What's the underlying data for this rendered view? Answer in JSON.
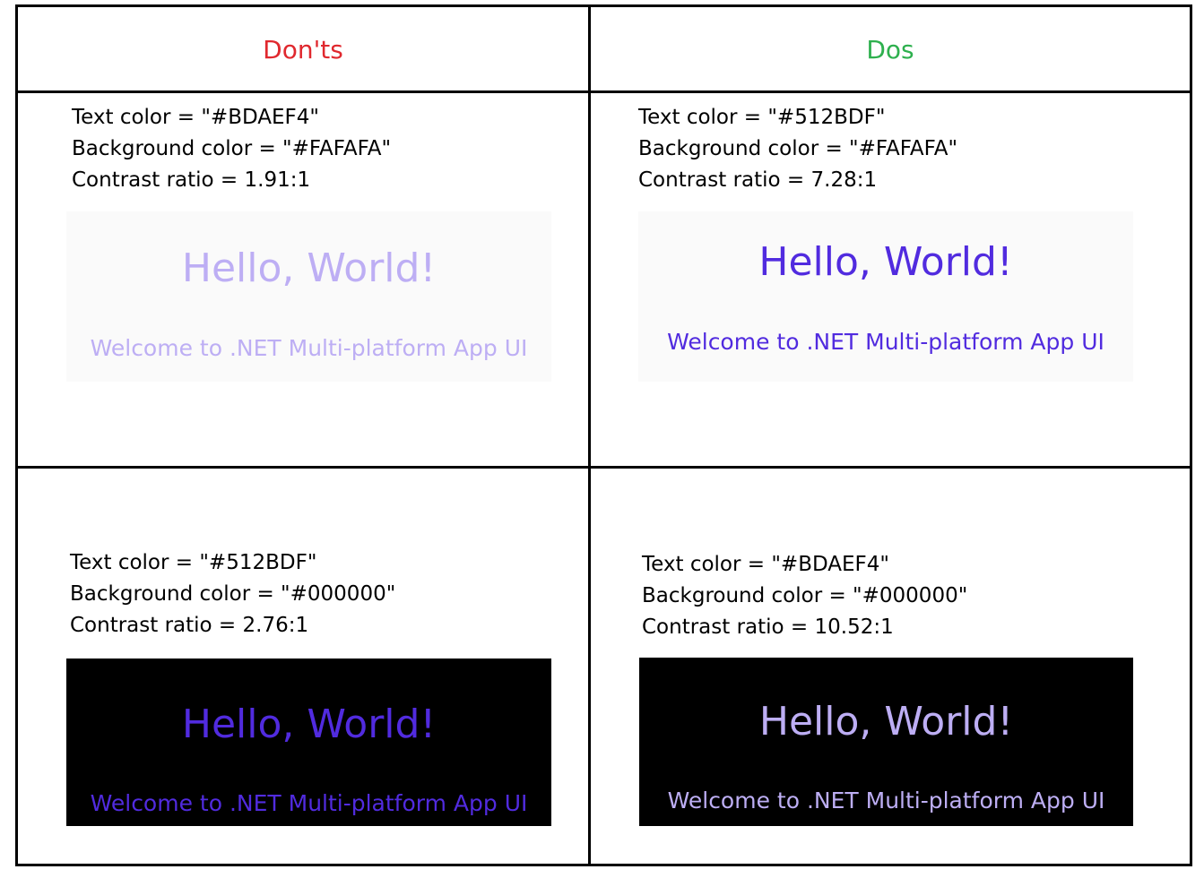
{
  "headers": {
    "donts": {
      "label": "Don'ts",
      "color": "#E0282E"
    },
    "dos": {
      "label": "Dos",
      "color": "#2EB04E"
    }
  },
  "examples": {
    "dont_light": {
      "text_color_line": "Text color = \"#BDAEF4\"",
      "background_color_line": "Background color = \"#FAFAFA\"",
      "contrast_line": "Contrast ratio =  1.91:1",
      "text_color": "#BDAEF4",
      "background_color": "#FAFAFA",
      "heading": "Hello, World!",
      "subheading": "Welcome to .NET Multi-platform App UI"
    },
    "do_light": {
      "text_color_line": "Text color = \"#512BDF\"",
      "background_color_line": "Background color = \"#FAFAFA\"",
      "contrast_line": "Contrast ratio =  7.28:1",
      "text_color": "#512BDF",
      "background_color": "#FAFAFA",
      "heading": "Hello, World!",
      "subheading": "Welcome to .NET Multi-platform App UI"
    },
    "dont_dark": {
      "text_color_line": "Text color = \"#512BDF\"",
      "background_color_line": "Background color = \"#000000\"",
      "contrast_line": "Contrast ratio = 2.76:1",
      "text_color": "#512BDF",
      "background_color": "#000000",
      "heading": "Hello, World!",
      "subheading": "Welcome to .NET Multi-platform App UI"
    },
    "do_dark": {
      "text_color_line": "Text color = \"#BDAEF4\"",
      "background_color_line": "Background color = \"#000000\"",
      "contrast_line": "Contrast ratio =  10.52:1",
      "text_color": "#BDAEF4",
      "background_color": "#000000",
      "heading": "Hello, World!",
      "subheading": "Welcome to .NET Multi-platform App UI"
    }
  }
}
